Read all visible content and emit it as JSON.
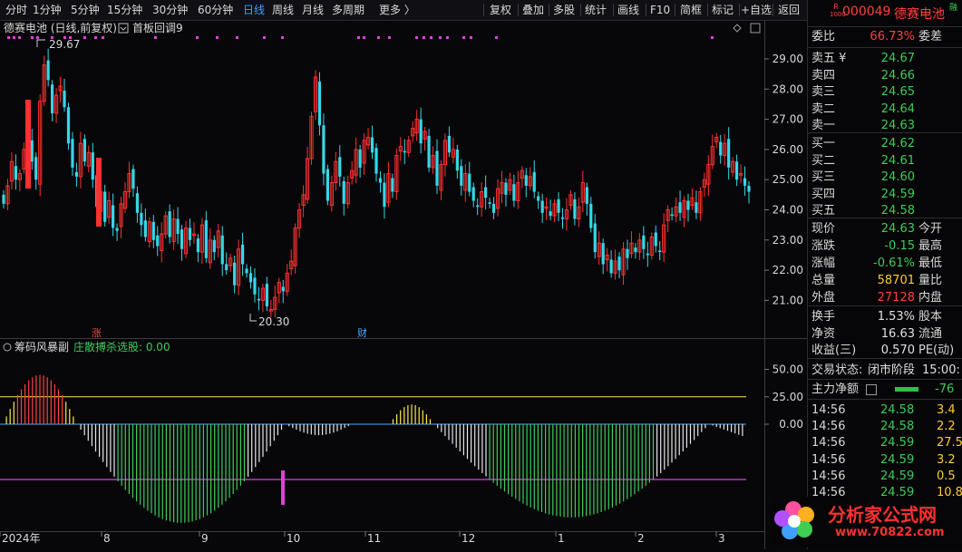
{
  "toolbar": {
    "periods": [
      "分时",
      "1分钟",
      "5分钟",
      "15分钟",
      "30分钟",
      "60分钟",
      "日线",
      "周线",
      "月线",
      "多周期",
      "更多 〉"
    ],
    "active_period": "日线",
    "tools": [
      "复权",
      "叠加",
      "多股",
      "统计",
      "画线",
      "F10",
      "简框",
      "标记",
      "+自选",
      "返回"
    ]
  },
  "chart": {
    "title": "德赛电池 (日线,前复权)",
    "indicator_name": "首板回调9",
    "y_ticks": [
      "29.00",
      "28.00",
      "27.00",
      "26.00",
      "25.00",
      "24.00",
      "23.00",
      "22.00",
      "21.00"
    ],
    "high_label": "29.67",
    "low_label": "20.30",
    "marker_zhang": "涨",
    "marker_cai": "财"
  },
  "sub": {
    "title": "筹码风暴副",
    "formula": "庄散搏杀选股: 0.00",
    "y_ticks": [
      "50.00",
      "25.00",
      "0.00"
    ]
  },
  "xaxis": [
    "2024年",
    "8",
    "9",
    "10",
    "11",
    "12",
    "1",
    "2",
    "3"
  ],
  "stock": {
    "badge_top": "R",
    "badge_bottom": "1000",
    "code": "000049",
    "name": "德赛电池",
    "corner": "融"
  },
  "weibi": {
    "label": "委比",
    "value": "66.73%",
    "label2": "委差"
  },
  "asks": [
    {
      "label": "卖五 ¥",
      "price": "24.67"
    },
    {
      "label": "卖四",
      "price": "24.66"
    },
    {
      "label": "卖三",
      "price": "24.65"
    },
    {
      "label": "卖二",
      "price": "24.64"
    },
    {
      "label": "卖一",
      "price": "24.63"
    }
  ],
  "bids": [
    {
      "label": "买一",
      "price": "24.62"
    },
    {
      "label": "买二",
      "price": "24.61"
    },
    {
      "label": "买三",
      "price": "24.60"
    },
    {
      "label": "买四",
      "price": "24.59"
    },
    {
      "label": "买五",
      "price": "24.58"
    }
  ],
  "quote": [
    {
      "label": "现价",
      "value": "24.63",
      "label2": "今开",
      "color": "green"
    },
    {
      "label": "涨跌",
      "value": "-0.15",
      "label2": "最高",
      "color": "green"
    },
    {
      "label": "涨幅",
      "value": "-0.61%",
      "label2": "最低",
      "color": "green"
    },
    {
      "label": "总量",
      "value": "58701",
      "label2": "量比",
      "color": "yellow"
    },
    {
      "label": "外盘",
      "value": "27128",
      "label2": "内盘",
      "color": "red"
    }
  ],
  "finance": [
    {
      "label": "换手",
      "value": "1.53%",
      "label2": "股本"
    },
    {
      "label": "净资",
      "value": "16.63",
      "label2": "流通"
    },
    {
      "label": "收益(三)",
      "value": "0.570",
      "label2": "PE(动)"
    }
  ],
  "status": {
    "label": "交易状态:",
    "value": "闭市阶段",
    "time": "15:00:"
  },
  "netflow": {
    "label": "主力净额",
    "value": "-76"
  },
  "trades": [
    {
      "time": "14:56",
      "price": "24.58",
      "vol": "3.4"
    },
    {
      "time": "14:56",
      "price": "24.58",
      "vol": "2.2"
    },
    {
      "time": "14:56",
      "price": "24.59",
      "vol": "27.5"
    },
    {
      "time": "14:56",
      "price": "24.59",
      "vol": "3.2"
    },
    {
      "time": "14:56",
      "price": "24.59",
      "vol": "0.5"
    },
    {
      "time": "14:56",
      "price": "24.59",
      "vol": "10.8"
    }
  ],
  "watermark": {
    "text": "分析家公式网",
    "url": "www.70822.com"
  },
  "colors": {
    "up": "#ff3030",
    "down": "#35d7e8",
    "line": "#ffe94a",
    "magenta": "#e040e0",
    "green": "#3dcc5a"
  }
}
